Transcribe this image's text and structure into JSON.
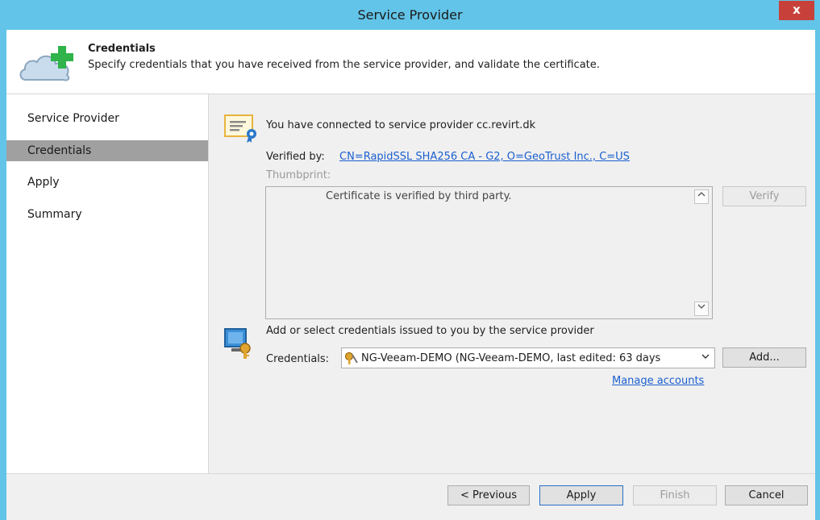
{
  "window": {
    "title": "Service Provider",
    "close_glyph": "x"
  },
  "header": {
    "title": "Credentials",
    "description": "Specify credentials that you have received from the service provider, and validate the certificate.",
    "icon": "cloud-plus-icon"
  },
  "sidebar": {
    "items": [
      {
        "label": "Service Provider",
        "active": false
      },
      {
        "label": "Credentials",
        "active": true
      },
      {
        "label": "Apply",
        "active": false
      },
      {
        "label": "Summary",
        "active": false
      }
    ]
  },
  "certificate": {
    "connected_text": "You have connected to service provider cc.revirt.dk",
    "verified_label": "Verified by:",
    "verified_value": "CN=RapidSSL SHA256 CA - G2, O=GeoTrust Inc., C=US",
    "thumbprint_label": "Thumbprint:",
    "thumbprint_text": "Certificate is verified by third party.",
    "verify_button": "Verify"
  },
  "credentials": {
    "heading": "Add or select credentials issued to you by the service provider",
    "label": "Credentials:",
    "selected": "NG-Veeam-DEMO (NG-Veeam-DEMO, last edited: 63 days",
    "add_button": "Add...",
    "manage_link": "Manage accounts"
  },
  "footer": {
    "previous": "< Previous",
    "apply": "Apply",
    "finish": "Finish",
    "cancel": "Cancel"
  },
  "colors": {
    "titlebar": "#62c4e8",
    "close": "#c7413a",
    "link": "#1a5fcf",
    "active_nav": "#a0a0a0",
    "cloud_plus": "#2fb34a"
  }
}
